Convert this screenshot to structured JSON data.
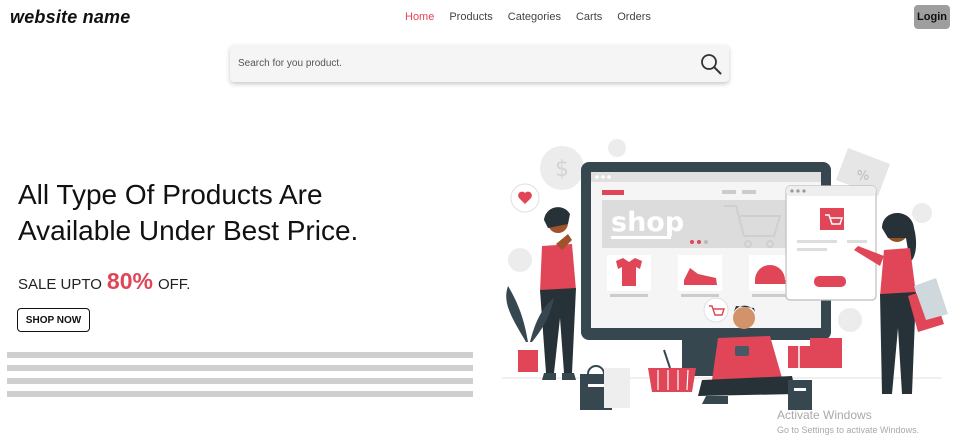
{
  "brand": {
    "name": "website name"
  },
  "nav": {
    "links": [
      {
        "label": "Home",
        "active": true
      },
      {
        "label": "Products",
        "active": false
      },
      {
        "label": "Categories",
        "active": false
      },
      {
        "label": "Carts",
        "active": false
      },
      {
        "label": "Orders",
        "active": false
      }
    ],
    "login_label": "Login"
  },
  "search": {
    "placeholder": "Search for you product.",
    "value": "",
    "icon": "search-icon"
  },
  "hero": {
    "title": "All Type Of Products Are Available Under Best Price.",
    "sale_prefix": "SALE UPTO",
    "sale_percent": "80%",
    "sale_suffix": "OFF.",
    "shop_label": "SHOP NOW",
    "illustration_text": "shop"
  },
  "watermark": {
    "title": "Activate Windows",
    "subtitle": "Go to Settings to activate Windows."
  },
  "colors": {
    "accent": "#e04657",
    "login_bg": "#9e9e9e",
    "dark": "#37474f",
    "stripe": "#cfcfcf"
  }
}
